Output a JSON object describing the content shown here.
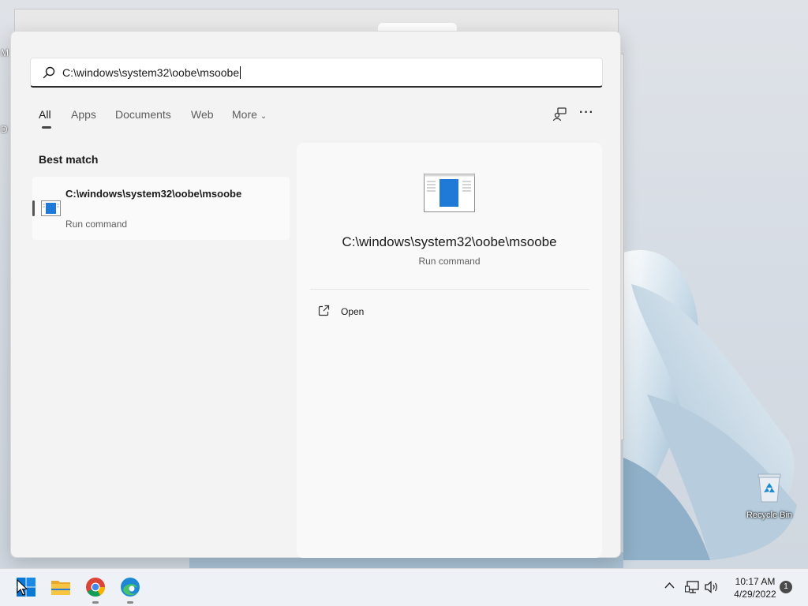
{
  "desktop": {
    "edge_letters": [
      "M",
      "D"
    ],
    "recycle_bin_label": "Recycle Bin"
  },
  "search": {
    "query": "C:\\windows\\system32\\oobe\\msoobe",
    "icon": "search-icon"
  },
  "filters": {
    "items": [
      {
        "label": "All",
        "active": true
      },
      {
        "label": "Apps",
        "active": false
      },
      {
        "label": "Documents",
        "active": false
      },
      {
        "label": "Web",
        "active": false
      },
      {
        "label": "More",
        "active": false
      }
    ],
    "share_icon": "share-device-icon",
    "more_options": "···"
  },
  "results": {
    "section_label": "Best match",
    "best_match": {
      "title": "C:\\windows\\system32\\oobe\\msoobe",
      "subtitle": "Run command",
      "icon": "run-command-icon"
    }
  },
  "detail": {
    "title": "C:\\windows\\system32\\oobe\\msoobe",
    "subtitle": "Run command",
    "actions": [
      {
        "label": "Open",
        "icon": "open-external-icon"
      }
    ]
  },
  "taskbar": {
    "apps": [
      {
        "name": "start",
        "icon": "windows-start-icon"
      },
      {
        "name": "file-explorer",
        "icon": "folder-icon"
      },
      {
        "name": "chrome",
        "icon": "chrome-icon"
      },
      {
        "name": "edge",
        "icon": "edge-icon"
      }
    ],
    "tray": {
      "chevron": "^",
      "time": "10:17 AM",
      "date": "4/29/2022",
      "notification_count": "1"
    }
  },
  "colors": {
    "accent_blue": "#0078d4",
    "panel_bg": "#f3f3f3",
    "taskbar_bg": "#eef1f5"
  }
}
